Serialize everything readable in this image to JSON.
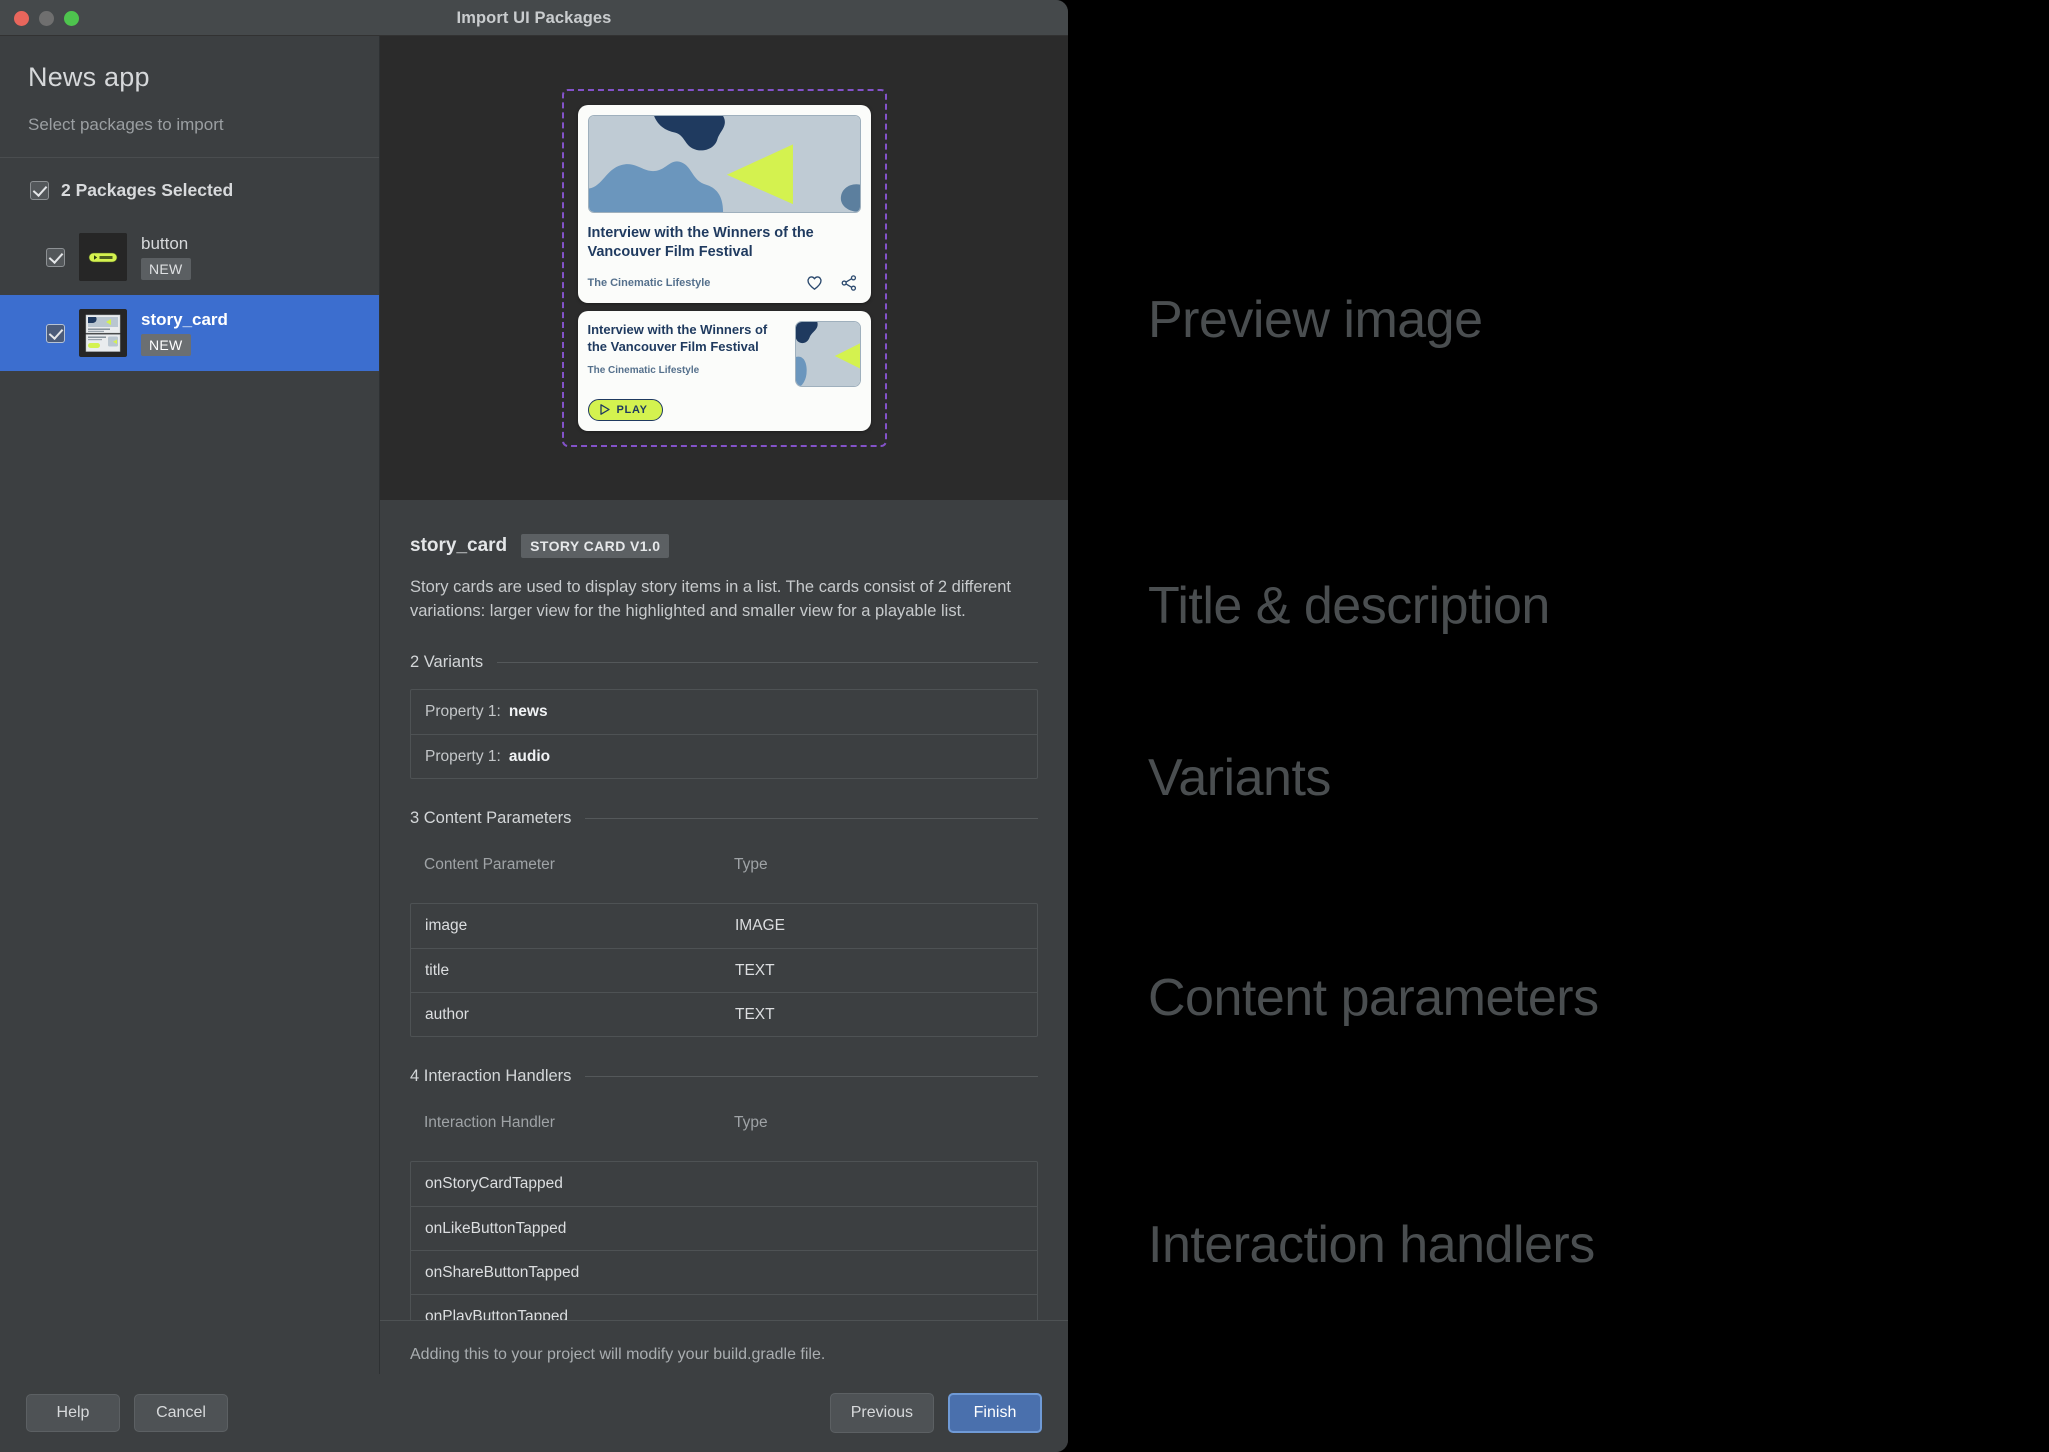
{
  "window": {
    "title": "Import UI Packages",
    "traffic_lights": [
      "close-red",
      "minimize-gray",
      "zoom-green"
    ]
  },
  "sidebar": {
    "app_title": "News app",
    "subtitle": "Select packages to import",
    "packages_header": "2 Packages Selected",
    "packages": [
      {
        "name": "button",
        "badge": "NEW",
        "checked": true,
        "selected": false
      },
      {
        "name": "story_card",
        "badge": "NEW",
        "checked": true,
        "selected": true
      }
    ]
  },
  "preview": {
    "card_large": {
      "title": "Interview with the Winners of the Vancouver Film Festival",
      "author": "The Cinematic Lifestyle",
      "icons": [
        "heart-icon",
        "share-icon"
      ]
    },
    "card_small": {
      "title": "Interview with the Winners of the Vancouver Film Festival",
      "author": "The Cinematic Lifestyle",
      "play_label": "PLAY"
    },
    "colors": {
      "accent_lime": "#d4f24f",
      "navy": "#1f3a5f",
      "steel_blue": "#6b96bd",
      "light_blue_gray": "#bfcbd4",
      "selection_dashed": "#8352c9"
    }
  },
  "details": {
    "name": "story_card",
    "version_badge": "STORY CARD V1.0",
    "description": "Story cards are used to display story items in a list. The cards consist of 2 different variations: larger view for the highlighted and smaller view for a playable list.",
    "variants": {
      "section_title": "2 Variants",
      "rows": [
        {
          "key": "Property 1:",
          "value": "news"
        },
        {
          "key": "Property 1:",
          "value": "audio"
        }
      ]
    },
    "content_parameters": {
      "section_title": "3 Content Parameters",
      "columns": [
        "Content Parameter",
        "Type"
      ],
      "rows": [
        {
          "name": "image",
          "type": "IMAGE"
        },
        {
          "name": "title",
          "type": "TEXT"
        },
        {
          "name": "author",
          "type": "TEXT"
        }
      ]
    },
    "interaction_handlers": {
      "section_title": "4 Interaction Handlers",
      "columns": [
        "Interaction Handler",
        "Type"
      ],
      "rows": [
        {
          "name": "onStoryCardTapped",
          "type": ""
        },
        {
          "name": "onLikeButtonTapped",
          "type": ""
        },
        {
          "name": "onShareButtonTapped",
          "type": ""
        },
        {
          "name": "onPlayButtonTapped",
          "type": ""
        }
      ]
    },
    "footer_note": "Adding this to your project will modify your build.gradle file."
  },
  "buttons": {
    "help": "Help",
    "cancel": "Cancel",
    "previous": "Previous",
    "finish": "Finish"
  },
  "annotations": [
    {
      "label": "Preview image"
    },
    {
      "label": "Title & description"
    },
    {
      "label": "Variants"
    },
    {
      "label": "Content parameters"
    },
    {
      "label": "Interaction handlers"
    }
  ]
}
